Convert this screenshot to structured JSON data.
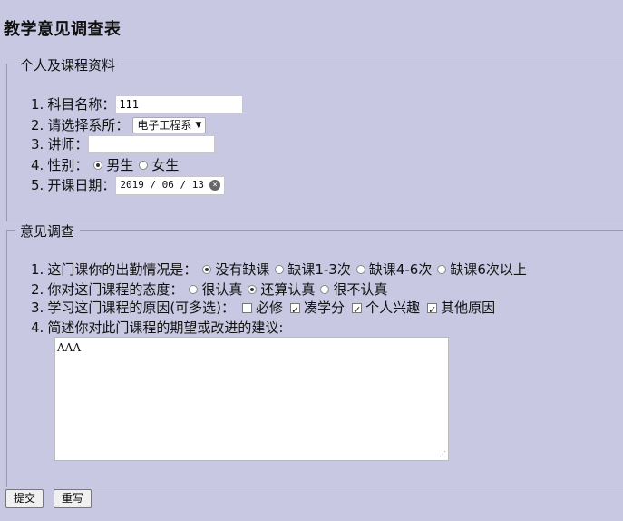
{
  "page_title": "教学意见调查表",
  "section1": {
    "legend": "个人及课程资料",
    "subject": {
      "num": "1.",
      "label": "科目名称：",
      "value": "111"
    },
    "dept": {
      "num": "2.",
      "label": "请选择系所：",
      "value": "电子工程系"
    },
    "teacher": {
      "num": "3.",
      "label": "讲师：",
      "value": ""
    },
    "gender": {
      "num": "4.",
      "label": "性别：",
      "opt1": "男生",
      "opt2": "女生"
    },
    "date": {
      "num": "5.",
      "label": "开课日期：",
      "value": "2019 / 06 / 13"
    }
  },
  "section2": {
    "legend": "意见调查",
    "q1": {
      "num": "1.",
      "label": "这门课你的出勤情况是：",
      "opt1": "没有缺课",
      "opt2": "缺课1-3次",
      "opt3": "缺课4-6次",
      "opt4": "缺课6次以上"
    },
    "q2": {
      "num": "2.",
      "label": "你对这门课程的态度：",
      "opt1": "很认真",
      "opt2": "还算认真",
      "opt3": "很不认真"
    },
    "q3": {
      "num": "3.",
      "label": "学习这门课程的原因(可多选)：",
      "opt1": "必修",
      "opt2": "凑学分",
      "opt3": "个人兴趣",
      "opt4": "其他原因"
    },
    "q4": {
      "num": "4.",
      "label": "简述你对此门课程的期望或改进的建议:",
      "value": "AAA"
    }
  },
  "buttons": {
    "submit": "提交",
    "reset": "重写"
  }
}
